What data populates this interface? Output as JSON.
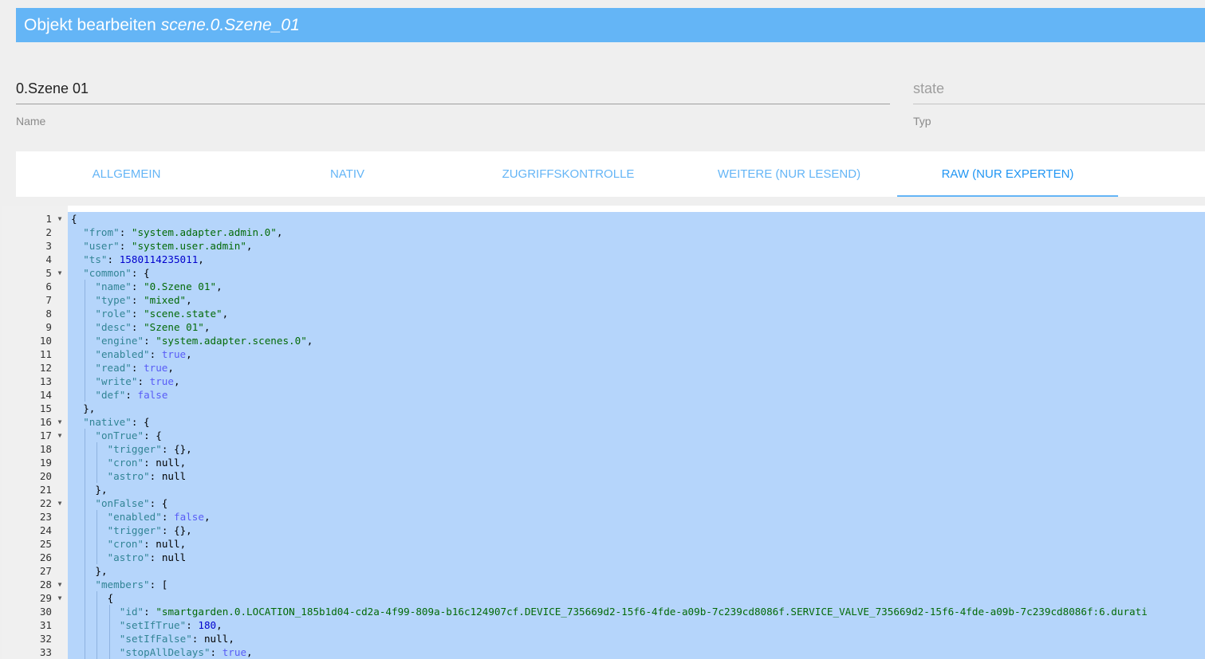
{
  "dialog": {
    "title": "Objekt bearbeiten",
    "object_id": "scene.0.Szene_01"
  },
  "fields": {
    "name": {
      "value": "0.Szene 01",
      "label": "Name"
    },
    "type": {
      "value": "state",
      "label": "Typ"
    }
  },
  "tabs": [
    {
      "label": "ALLGEMEIN",
      "active": false
    },
    {
      "label": "NATIV",
      "active": false
    },
    {
      "label": "ZUGRIFFSKONTROLLE",
      "active": false
    },
    {
      "label": "WEITERE (NUR LESEND)",
      "active": false
    },
    {
      "label": "RAW (NUR EXPERTEN)",
      "active": true
    }
  ],
  "editor": {
    "fold_icon": "fold-arrow-icon",
    "selection_color": "#b5d5fb",
    "lines": [
      {
        "n": 1,
        "fold": true,
        "indent": 0,
        "tokens": [
          {
            "t": "p",
            "v": "{"
          }
        ]
      },
      {
        "n": 2,
        "fold": false,
        "indent": 1,
        "tokens": [
          {
            "t": "k",
            "v": "\"from\""
          },
          {
            "t": "p",
            "v": ": "
          },
          {
            "t": "s",
            "v": "\"system.adapter.admin.0\""
          },
          {
            "t": "p",
            "v": ","
          }
        ]
      },
      {
        "n": 3,
        "fold": false,
        "indent": 1,
        "tokens": [
          {
            "t": "k",
            "v": "\"user\""
          },
          {
            "t": "p",
            "v": ": "
          },
          {
            "t": "s",
            "v": "\"system.user.admin\""
          },
          {
            "t": "p",
            "v": ","
          }
        ]
      },
      {
        "n": 4,
        "fold": false,
        "indent": 1,
        "tokens": [
          {
            "t": "k",
            "v": "\"ts\""
          },
          {
            "t": "p",
            "v": ": "
          },
          {
            "t": "n",
            "v": "1580114235011"
          },
          {
            "t": "p",
            "v": ","
          }
        ]
      },
      {
        "n": 5,
        "fold": true,
        "indent": 1,
        "tokens": [
          {
            "t": "k",
            "v": "\"common\""
          },
          {
            "t": "p",
            "v": ": {"
          }
        ]
      },
      {
        "n": 6,
        "fold": false,
        "indent": 2,
        "tokens": [
          {
            "t": "k",
            "v": "\"name\""
          },
          {
            "t": "p",
            "v": ": "
          },
          {
            "t": "s",
            "v": "\"0.Szene 01\""
          },
          {
            "t": "p",
            "v": ","
          }
        ]
      },
      {
        "n": 7,
        "fold": false,
        "indent": 2,
        "tokens": [
          {
            "t": "k",
            "v": "\"type\""
          },
          {
            "t": "p",
            "v": ": "
          },
          {
            "t": "s",
            "v": "\"mixed\""
          },
          {
            "t": "p",
            "v": ","
          }
        ]
      },
      {
        "n": 8,
        "fold": false,
        "indent": 2,
        "tokens": [
          {
            "t": "k",
            "v": "\"role\""
          },
          {
            "t": "p",
            "v": ": "
          },
          {
            "t": "s",
            "v": "\"scene.state\""
          },
          {
            "t": "p",
            "v": ","
          }
        ]
      },
      {
        "n": 9,
        "fold": false,
        "indent": 2,
        "tokens": [
          {
            "t": "k",
            "v": "\"desc\""
          },
          {
            "t": "p",
            "v": ": "
          },
          {
            "t": "s",
            "v": "\"Szene 01\""
          },
          {
            "t": "p",
            "v": ","
          }
        ]
      },
      {
        "n": 10,
        "fold": false,
        "indent": 2,
        "tokens": [
          {
            "t": "k",
            "v": "\"engine\""
          },
          {
            "t": "p",
            "v": ": "
          },
          {
            "t": "s",
            "v": "\"system.adapter.scenes.0\""
          },
          {
            "t": "p",
            "v": ","
          }
        ]
      },
      {
        "n": 11,
        "fold": false,
        "indent": 2,
        "tokens": [
          {
            "t": "k",
            "v": "\"enabled\""
          },
          {
            "t": "p",
            "v": ": "
          },
          {
            "t": "b",
            "v": "true"
          },
          {
            "t": "p",
            "v": ","
          }
        ]
      },
      {
        "n": 12,
        "fold": false,
        "indent": 2,
        "tokens": [
          {
            "t": "k",
            "v": "\"read\""
          },
          {
            "t": "p",
            "v": ": "
          },
          {
            "t": "b",
            "v": "true"
          },
          {
            "t": "p",
            "v": ","
          }
        ]
      },
      {
        "n": 13,
        "fold": false,
        "indent": 2,
        "tokens": [
          {
            "t": "k",
            "v": "\"write\""
          },
          {
            "t": "p",
            "v": ": "
          },
          {
            "t": "b",
            "v": "true"
          },
          {
            "t": "p",
            "v": ","
          }
        ]
      },
      {
        "n": 14,
        "fold": false,
        "indent": 2,
        "tokens": [
          {
            "t": "k",
            "v": "\"def\""
          },
          {
            "t": "p",
            "v": ": "
          },
          {
            "t": "b",
            "v": "false"
          }
        ]
      },
      {
        "n": 15,
        "fold": false,
        "indent": 1,
        "tokens": [
          {
            "t": "p",
            "v": "},"
          }
        ]
      },
      {
        "n": 16,
        "fold": true,
        "indent": 1,
        "tokens": [
          {
            "t": "k",
            "v": "\"native\""
          },
          {
            "t": "p",
            "v": ": {"
          }
        ]
      },
      {
        "n": 17,
        "fold": true,
        "indent": 2,
        "tokens": [
          {
            "t": "k",
            "v": "\"onTrue\""
          },
          {
            "t": "p",
            "v": ": {"
          }
        ]
      },
      {
        "n": 18,
        "fold": false,
        "indent": 3,
        "tokens": [
          {
            "t": "k",
            "v": "\"trigger\""
          },
          {
            "t": "p",
            "v": ": {},"
          }
        ]
      },
      {
        "n": 19,
        "fold": false,
        "indent": 3,
        "tokens": [
          {
            "t": "k",
            "v": "\"cron\""
          },
          {
            "t": "p",
            "v": ": "
          },
          {
            "t": "nl",
            "v": "null"
          },
          {
            "t": "p",
            "v": ","
          }
        ]
      },
      {
        "n": 20,
        "fold": false,
        "indent": 3,
        "tokens": [
          {
            "t": "k",
            "v": "\"astro\""
          },
          {
            "t": "p",
            "v": ": "
          },
          {
            "t": "nl",
            "v": "null"
          }
        ]
      },
      {
        "n": 21,
        "fold": false,
        "indent": 2,
        "tokens": [
          {
            "t": "p",
            "v": "},"
          }
        ]
      },
      {
        "n": 22,
        "fold": true,
        "indent": 2,
        "tokens": [
          {
            "t": "k",
            "v": "\"onFalse\""
          },
          {
            "t": "p",
            "v": ": {"
          }
        ]
      },
      {
        "n": 23,
        "fold": false,
        "indent": 3,
        "tokens": [
          {
            "t": "k",
            "v": "\"enabled\""
          },
          {
            "t": "p",
            "v": ": "
          },
          {
            "t": "b",
            "v": "false"
          },
          {
            "t": "p",
            "v": ","
          }
        ]
      },
      {
        "n": 24,
        "fold": false,
        "indent": 3,
        "tokens": [
          {
            "t": "k",
            "v": "\"trigger\""
          },
          {
            "t": "p",
            "v": ": {},"
          }
        ]
      },
      {
        "n": 25,
        "fold": false,
        "indent": 3,
        "tokens": [
          {
            "t": "k",
            "v": "\"cron\""
          },
          {
            "t": "p",
            "v": ": "
          },
          {
            "t": "nl",
            "v": "null"
          },
          {
            "t": "p",
            "v": ","
          }
        ]
      },
      {
        "n": 26,
        "fold": false,
        "indent": 3,
        "tokens": [
          {
            "t": "k",
            "v": "\"astro\""
          },
          {
            "t": "p",
            "v": ": "
          },
          {
            "t": "nl",
            "v": "null"
          }
        ]
      },
      {
        "n": 27,
        "fold": false,
        "indent": 2,
        "tokens": [
          {
            "t": "p",
            "v": "},"
          }
        ]
      },
      {
        "n": 28,
        "fold": true,
        "indent": 2,
        "tokens": [
          {
            "t": "k",
            "v": "\"members\""
          },
          {
            "t": "p",
            "v": ": ["
          }
        ]
      },
      {
        "n": 29,
        "fold": true,
        "indent": 3,
        "tokens": [
          {
            "t": "p",
            "v": "{"
          }
        ]
      },
      {
        "n": 30,
        "fold": false,
        "indent": 4,
        "tokens": [
          {
            "t": "k",
            "v": "\"id\""
          },
          {
            "t": "p",
            "v": ": "
          },
          {
            "t": "s",
            "v": "\"smartgarden.0.LOCATION_185b1d04-cd2a-4f99-809a-b16c124907cf.DEVICE_735669d2-15f6-4fde-a09b-7c239cd8086f.SERVICE_VALVE_735669d2-15f6-4fde-a09b-7c239cd8086f:6.durati"
          }
        ]
      },
      {
        "n": 31,
        "fold": false,
        "indent": 4,
        "tokens": [
          {
            "t": "k",
            "v": "\"setIfTrue\""
          },
          {
            "t": "p",
            "v": ": "
          },
          {
            "t": "n",
            "v": "180"
          },
          {
            "t": "p",
            "v": ","
          }
        ]
      },
      {
        "n": 32,
        "fold": false,
        "indent": 4,
        "tokens": [
          {
            "t": "k",
            "v": "\"setIfFalse\""
          },
          {
            "t": "p",
            "v": ": "
          },
          {
            "t": "nl",
            "v": "null"
          },
          {
            "t": "p",
            "v": ","
          }
        ]
      },
      {
        "n": 33,
        "fold": false,
        "indent": 4,
        "tokens": [
          {
            "t": "k",
            "v": "\"stopAllDelays\""
          },
          {
            "t": "p",
            "v": ": "
          },
          {
            "t": "b",
            "v": "true"
          },
          {
            "t": "p",
            "v": ","
          }
        ]
      }
    ]
  }
}
